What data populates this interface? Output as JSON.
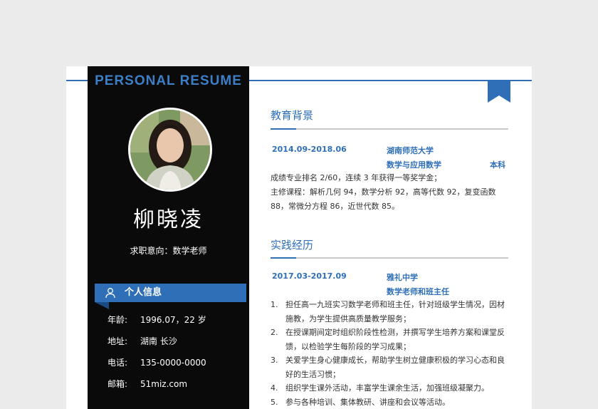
{
  "header": {
    "title": "PERSONAL RESUME"
  },
  "profile": {
    "name": "柳晓凌",
    "objective": "求职意向：数学老师"
  },
  "personal_info": {
    "section_title": "个人信息",
    "rows": [
      {
        "label": "年龄:",
        "value": "1996.07，22 岁"
      },
      {
        "label": "地址:",
        "value": "湖南  长沙"
      },
      {
        "label": "电话:",
        "value": "135-0000-0000"
      },
      {
        "label": "邮箱:",
        "value": "51miz.com"
      }
    ]
  },
  "education": {
    "section_title": "教育背景",
    "period": "2014.09-2018.06",
    "school": "湖南师范大学",
    "major": "数学与应用数学",
    "degree": "本科",
    "lines": [
      "成绩专业排名 2/60，连续 3 年获得一等奖学金；",
      "主修课程：解析几何 94，数学分析 92，高等代数 92，复变函数",
      "88，常微分方程 86，近世代数 85。"
    ]
  },
  "practice": {
    "section_title": "实践经历",
    "period": "2017.03-2017.09",
    "org": "雅礼中学",
    "role": "数学老师和班主任",
    "items": [
      {
        "num": "1.",
        "text": "担任高一九班实习数学老师和班主任，针对班级学生情况，因材施教，为学生提供高质量教学服务；"
      },
      {
        "num": "2.",
        "text": "在授课期间定时组织阶段性检测，并撰写学生培养方案和课堂反馈，以检验学生每阶段的学习成果；"
      },
      {
        "num": "3.",
        "text": "关爱学生身心健康成长，帮助学生树立健康积极的学习心态和良好的生活习惯；"
      },
      {
        "num": "4.",
        "text": "组织学生课外活动，丰富学生课余生活，加强班级凝聚力。"
      },
      {
        "num": "5.",
        "text": "参与各种培训、集体教研、讲座和会议等活动。"
      }
    ]
  },
  "colors": {
    "accent": "#2e6fb7",
    "sidebar": "#0a0a0a",
    "background": "#ebebeb"
  },
  "icons": {
    "section": "user-icon",
    "corner": "bookmark-icon"
  }
}
